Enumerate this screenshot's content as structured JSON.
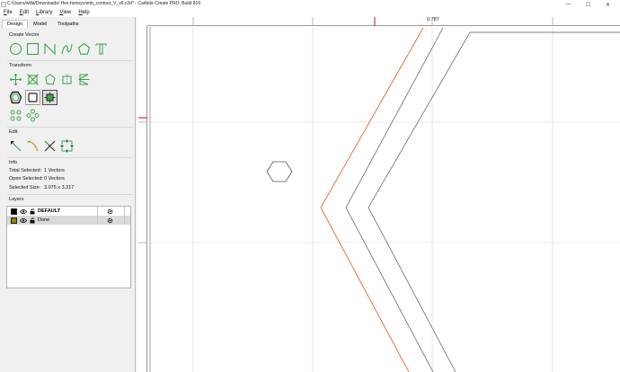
{
  "window": {
    "title": "C:/Users/willa/Downloads/ Hex-honeycomb_contour_V_v6.c2d* - Carbide Create PRO, Build 816",
    "minimize_glyph": "—",
    "maximize_glyph": "☐",
    "close_glyph": "✕"
  },
  "menu": [
    {
      "first": "F",
      "rest": "ile"
    },
    {
      "first": "E",
      "rest": "dit"
    },
    {
      "first": "L",
      "rest": "ibrary"
    },
    {
      "first": "V",
      "rest": "iew"
    },
    {
      "first": "H",
      "rest": "elp"
    }
  ],
  "tabs": [
    "Design",
    "Model",
    "Toolpaths"
  ],
  "sections": {
    "create_vector": "Create Vector",
    "transform": "Transform",
    "edit": "Edit",
    "info": "Info",
    "layers": "Layers"
  },
  "create_vector_icons": [
    "circle-icon",
    "rectangle-icon",
    "polyline-icon",
    "curve-icon",
    "polygon-icon",
    "text-icon"
  ],
  "transform_icons_row1": [
    "move-icon",
    "scale-icon",
    "rotate-icon",
    "align-icon",
    "mirror-icon"
  ],
  "transform_icons_row2": [
    "offset-icon",
    "boolean-union-icon",
    "boolean-subtract-icon"
  ],
  "transform_icons_row3": [
    "circular-pattern-icon",
    "grid-pattern-icon"
  ],
  "edit_icons": [
    "node-edit-icon",
    "curve-edit-icon",
    "trim-icon",
    "join-icon"
  ],
  "info": {
    "total_selected_label": "Total Selected:",
    "total_selected_value": "1 Vectors",
    "open_selected_label": "Open Selected:",
    "open_selected_value": "0 Vectors",
    "selected_size_label": "Selected Size:",
    "selected_size_value": "3.075 x 3.317"
  },
  "layers": [
    {
      "name": "DEFAULT",
      "color": "#000000",
      "bold": true,
      "selected": false
    },
    {
      "name": "Done",
      "color": "#8c8500",
      "bold": false,
      "selected": true
    }
  ],
  "ruler": {
    "top_value": "0.787"
  },
  "colors": {
    "accent_green": "#3aa34a",
    "selection_orange": "#e8622a",
    "ruler_marker_red": "#d83030",
    "grid_line": "#d6d6d6",
    "vector_line": "#555555"
  }
}
